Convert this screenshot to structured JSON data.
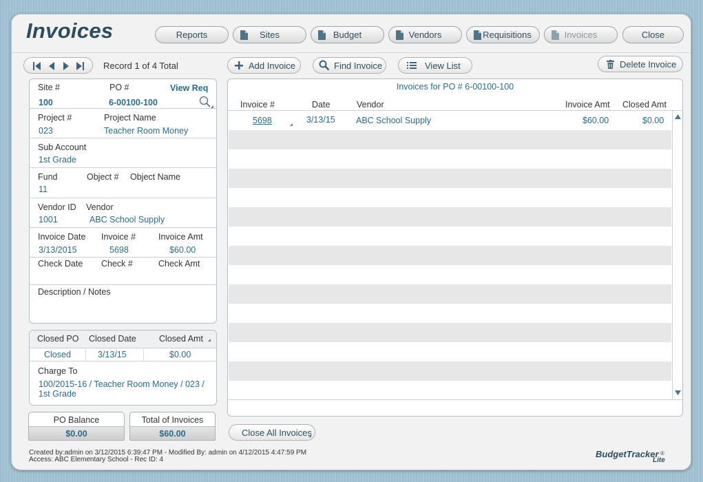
{
  "window": {
    "title": "Invoices"
  },
  "nav": {
    "reports": "Reports",
    "sites": "Sites",
    "budget": "Budget",
    "vendors": "Vendors",
    "requisitions": "Requisitions",
    "invoices": "Invoices",
    "close": "Close"
  },
  "toolbar": {
    "record_label": "Record 1 of 4 Total",
    "add_invoice": "Add Invoice",
    "find_invoice": "Find Invoice",
    "view_list": "View List",
    "delete_invoice": "Delete Invoice"
  },
  "detail": {
    "site_label": "Site #",
    "site_value": "100",
    "po_label": "PO #",
    "po_value": "6-00100-100",
    "view_req": "View Req",
    "project_num_label": "Project #",
    "project_num_value": "023",
    "project_name_label": "Project Name",
    "project_name_value": "Teacher Room Money",
    "sub_account_label": "Sub Account",
    "sub_account_value": "1st Grade",
    "fund_label": "Fund",
    "fund_value": "11",
    "object_num_label": "Object #",
    "object_name_label": "Object Name",
    "vendor_id_label": "Vendor ID",
    "vendor_id_value": "1001",
    "vendor_label": "Vendor",
    "vendor_value": "ABC School Supply",
    "invoice_date_label": "Invoice Date",
    "invoice_date_value": "3/13/2015",
    "invoice_num_label": "Invoice #",
    "invoice_num_value": "5698",
    "invoice_amt_label": "Invoice Amt",
    "invoice_amt_value": "$60.00",
    "check_date_label": "Check Date",
    "check_num_label": "Check #",
    "check_amt_label": "Check Amt",
    "description_label": "Description / Notes"
  },
  "closed": {
    "closed_po_label": "Closed PO",
    "closed_date_label": "Closed Date",
    "closed_amt_label": "Closed Amt",
    "closed_po_value": "Closed",
    "closed_date_value": "3/13/15",
    "closed_amt_value": "$0.00",
    "charge_to_label": "Charge To",
    "charge_to_value": "100/2015-16 / Teacher Room Money / 023 / 1st Grade"
  },
  "balance": {
    "po_balance_label": "PO Balance",
    "po_balance_value": "$0.00",
    "total_invoices_label": "Total of Invoices",
    "total_invoices_value": "$60.00"
  },
  "grid": {
    "title": "Invoices for PO # 6-00100-100",
    "columns": [
      "Invoice #",
      "Date",
      "Vendor",
      "Invoice Amt",
      "Closed Amt"
    ],
    "rows": [
      {
        "invoice": "5698",
        "date": "3/13/15",
        "vendor": "ABC School Supply",
        "invoice_amt": "$60.00",
        "closed_amt": "$0.00"
      }
    ]
  },
  "close_all": "Close All Invoices",
  "footer": {
    "created": "Created by:admin on 3/12/2015 6:39:47 PM - Modified By: admin on 4/12/2015 4:47:59 PM",
    "access": "Access: ABC Elementary School - Rec ID: 4"
  },
  "brand": {
    "name": "BudgetTracker",
    "sub": "Lite",
    "reg": "®"
  },
  "colors": {
    "accent": "#2a6b8c",
    "title": "#2d4d5e",
    "alt_row": "#e7e7e7"
  }
}
